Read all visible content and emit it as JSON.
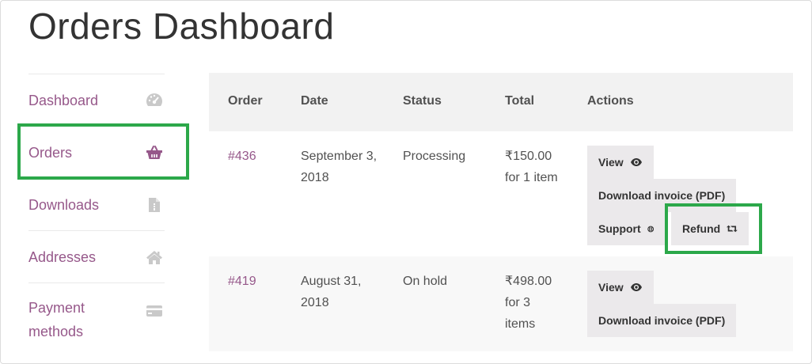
{
  "page": {
    "title": "Orders Dashboard"
  },
  "sidebar": {
    "items": [
      {
        "label": "Dashboard",
        "icon": "dashboard-gauge-icon"
      },
      {
        "label": "Orders",
        "icon": "basket-icon",
        "highlighted": true
      },
      {
        "label": "Downloads",
        "icon": "file-icon"
      },
      {
        "label": "Addresses",
        "icon": "home-icon"
      },
      {
        "label": "Payment methods",
        "icon": "credit-card-icon"
      }
    ]
  },
  "table": {
    "headers": [
      "Order",
      "Date",
      "Status",
      "Total",
      "Actions"
    ],
    "rows": [
      {
        "order": "#436",
        "date": "September 3, 2018",
        "status": "Processing",
        "total": "₹150.00 for 1 item",
        "actions": {
          "view": "View",
          "invoice": "Download invoice (PDF)",
          "support": "Support",
          "refund": "Refund"
        }
      },
      {
        "order": "#419",
        "date": "August 31, 2018",
        "status": "On hold",
        "total": "₹498.00 for 3 items",
        "actions": {
          "view": "View",
          "invoice": "Download invoice (PDF)"
        }
      }
    ]
  },
  "colors": {
    "link": "#96588a",
    "highlight": "#2ca84a",
    "header_bg": "#f2f2f2",
    "button_bg": "#ebe9eb"
  }
}
